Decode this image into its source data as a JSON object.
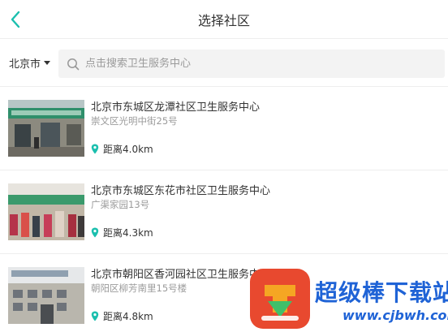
{
  "header": {
    "title": "选择社区"
  },
  "filter": {
    "city": "北京市",
    "search_placeholder": "点击搜索卫生服务中心"
  },
  "centers": [
    {
      "name": "北京市东城区龙潭社区卫生服务中心",
      "address": "崇文区光明中街25号",
      "distance": "距离4.0km"
    },
    {
      "name": "北京市东城区东花市社区卫生服务中心",
      "address": "广渠家园13号",
      "distance": "距离4.3km"
    },
    {
      "name": "北京市朝阳区香河园社区卫生服务中心",
      "address": "朝阳区柳芳南里15号楼",
      "distance": "距离4.8km"
    }
  ],
  "watermark": {
    "title": "超级棒下载站",
    "url": "www.cjbwh.com"
  },
  "colors": {
    "accent": "#1bbfae",
    "watermark_blue": "#1f63d6",
    "watermark_red": "#e8492f"
  },
  "icons": {
    "back": "chevron-left-icon",
    "search": "search-icon",
    "location": "location-pin-icon",
    "dropdown": "caret-down-icon"
  }
}
